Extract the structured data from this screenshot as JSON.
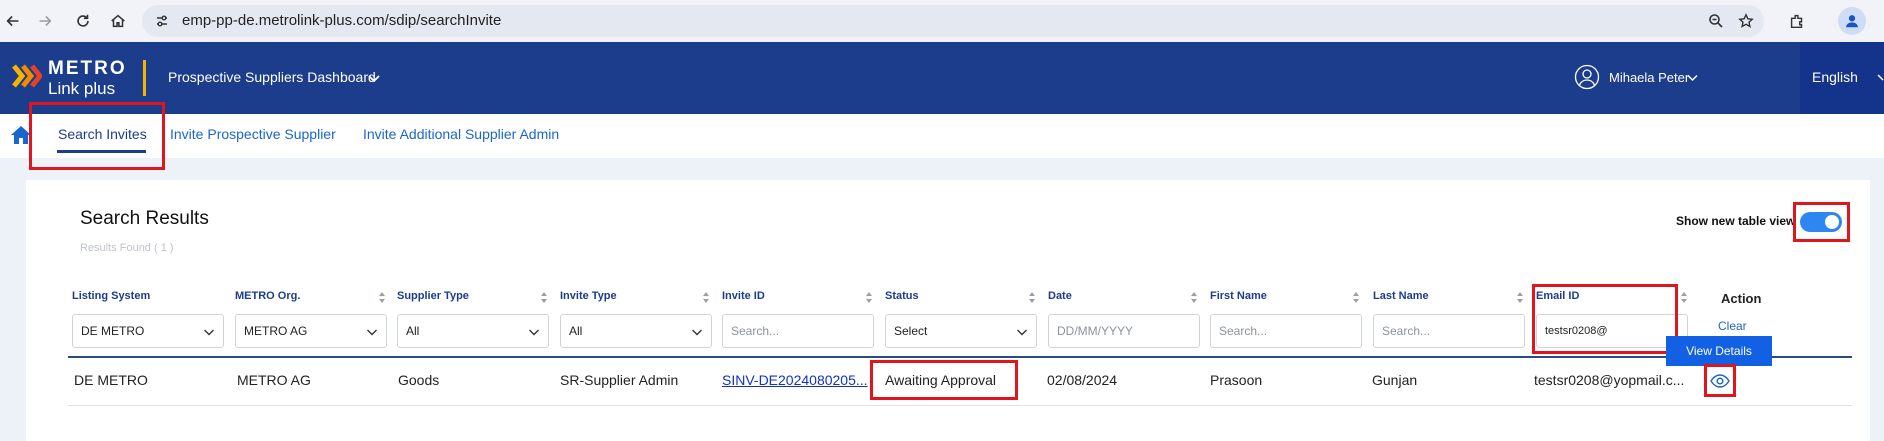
{
  "browser": {
    "url": "emp-pp-de.metrolink-plus.com/sdip/searchInvite",
    "icons": [
      "back-icon",
      "forward-icon",
      "reload-icon",
      "home-icon",
      "site-info-icon",
      "zoom-icon",
      "bookmark-star-icon",
      "extensions-icon",
      "profile-icon"
    ]
  },
  "header": {
    "brand_top": "METRO",
    "brand_bottom": "Link plus",
    "app_title": "Prospective Suppliers Dashboard",
    "user_name": "Mihaela Peter",
    "language": "English",
    "colors": {
      "header_bg": "#1c3c8c",
      "divider": "#f6b500"
    }
  },
  "tabs": [
    {
      "label": "Search Invites",
      "active": true
    },
    {
      "label": "Invite Prospective Supplier",
      "active": false
    },
    {
      "label": "Invite Additional Supplier Admin",
      "active": false
    }
  ],
  "results": {
    "title": "Search Results",
    "found": "Results Found ( 1 )",
    "toggle_label": "Show new table view",
    "toggle_on": true
  },
  "table": {
    "columns": [
      "Listing System",
      "METRO Org.",
      "Supplier Type",
      "Invite Type",
      "Invite ID",
      "Status",
      "Date",
      "First Name",
      "Last Name",
      "Email ID"
    ],
    "action_header": "Action",
    "filters": {
      "listing_system": "DE METRO",
      "metro_org": "METRO AG",
      "supplier_type": "All",
      "invite_type": "All",
      "invite_id_placeholder": "Search...",
      "status": "Select",
      "date_placeholder": "DD/MM/YYYY",
      "first_name_placeholder": "Search...",
      "last_name_placeholder": "Search...",
      "email_value": "testsr0208@"
    },
    "clear_label": "Clear",
    "view_details_label": "View Details",
    "rows": [
      {
        "listing_system": "DE METRO",
        "metro_org": "METRO AG",
        "supplier_type": "Goods",
        "invite_type": "SR-Supplier Admin",
        "invite_id": "SINV-DE2024080205...",
        "status": "Awaiting Approval",
        "date": "02/08/2024",
        "first_name": "Prasoon",
        "last_name": "Gunjan",
        "email": "testsr0208@yopmail.c..."
      }
    ]
  }
}
